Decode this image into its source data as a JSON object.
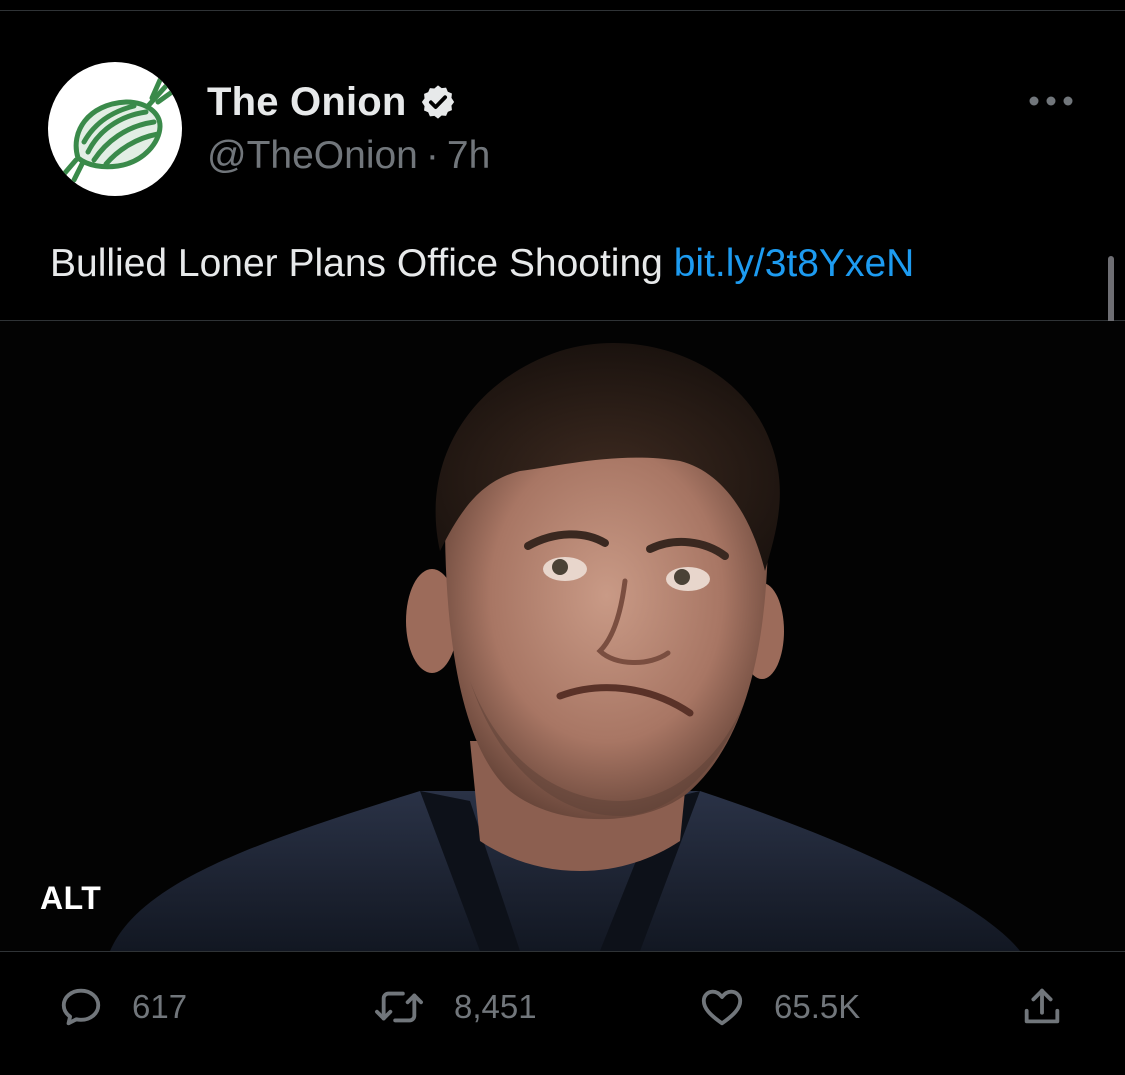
{
  "tweet": {
    "author": {
      "display_name": "The Onion",
      "handle": "@TheOnion",
      "separator": "·",
      "timestamp": "7h",
      "verified": true,
      "avatar_icon": "onion-logo-icon"
    },
    "text": "Bullied Loner Plans Office Shooting",
    "link_text": "bit.ly/3t8YxeN",
    "media": {
      "alt_badge": "ALT"
    },
    "actions": {
      "replies": "617",
      "retweets": "8,451",
      "likes": "65.5K"
    }
  },
  "icons": {
    "more": "more-horizontal-icon",
    "reply": "reply-bubble-icon",
    "retweet": "retweet-icon",
    "like": "heart-icon",
    "share": "share-icon"
  },
  "colors": {
    "background": "#000000",
    "text_primary": "#e7e9ea",
    "text_secondary": "#71767b",
    "link": "#1d9bf0",
    "divider": "#2f3336",
    "onion_green": "#3a8a4a"
  }
}
